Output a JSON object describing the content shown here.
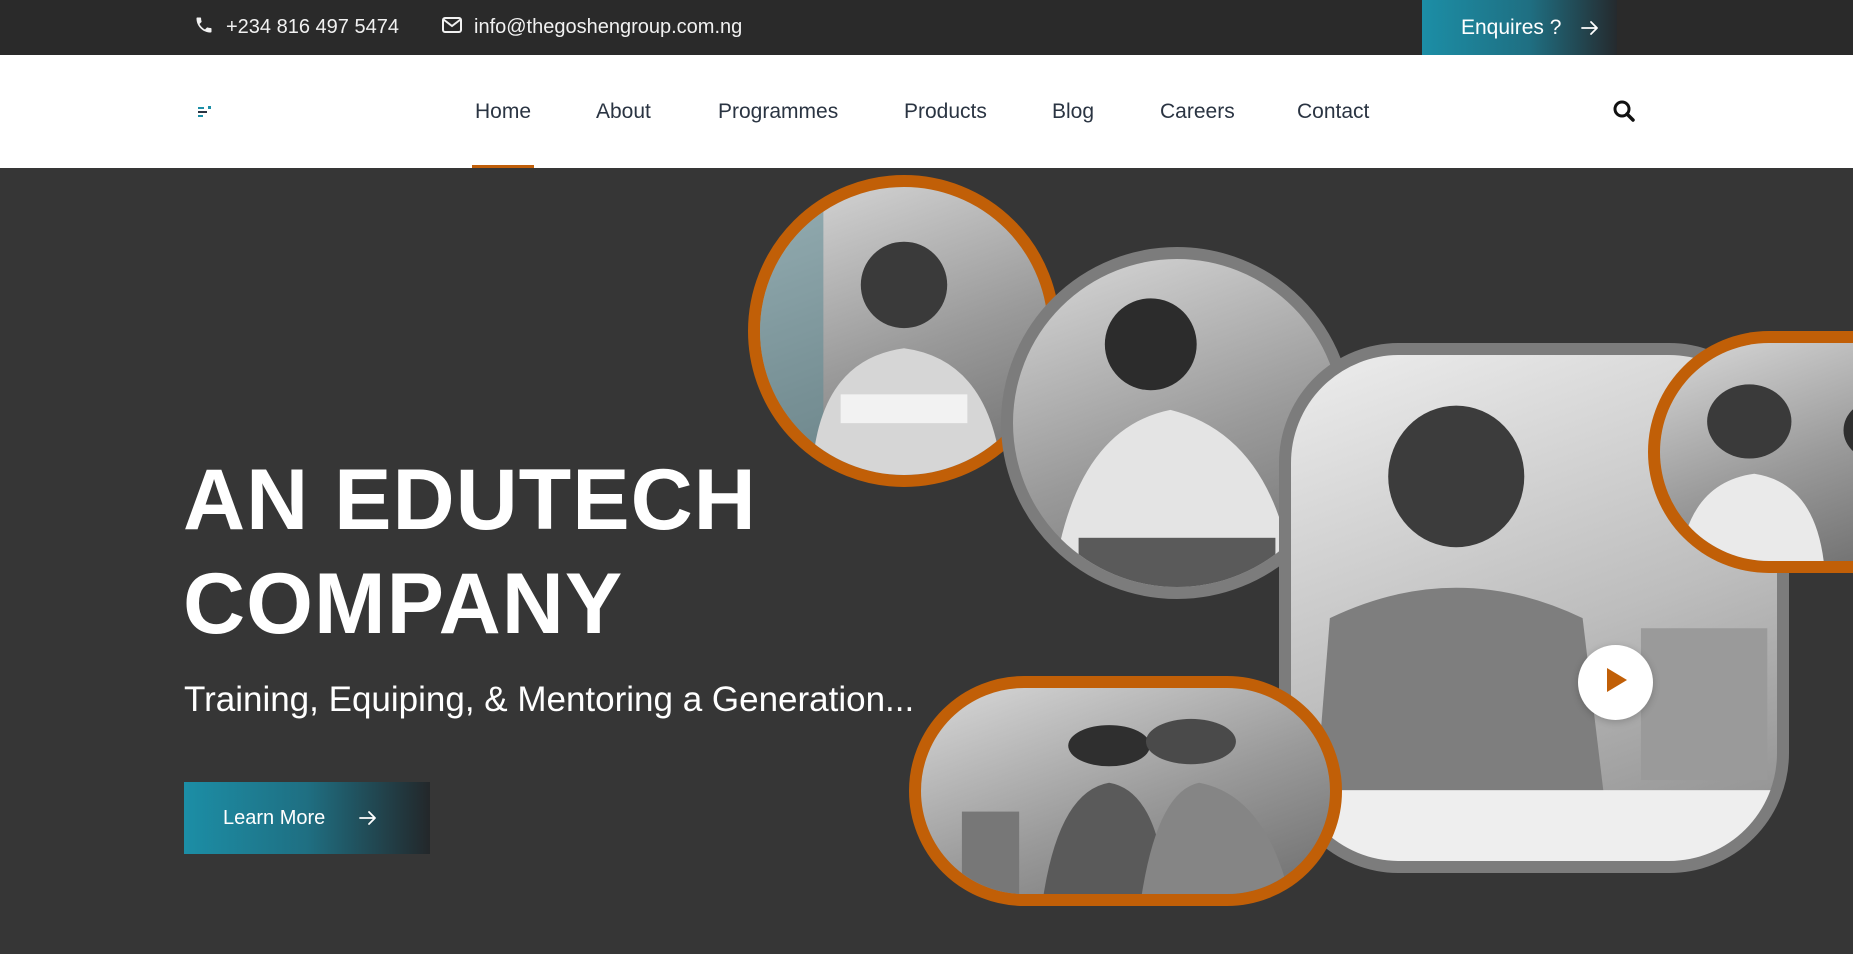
{
  "topbar": {
    "phone": "+234 816 497 5474",
    "email": "info@thegoshengroup.com.ng",
    "enquire_label": "Enquires ?"
  },
  "nav": {
    "items": [
      {
        "label": "Home",
        "active": true
      },
      {
        "label": "About"
      },
      {
        "label": "Programmes"
      },
      {
        "label": "Products"
      },
      {
        "label": "Blog"
      },
      {
        "label": "Careers"
      },
      {
        "label": "Contact"
      }
    ]
  },
  "hero": {
    "title_line1": "AN EDUTECH",
    "title_line2": "COMPANY",
    "subtitle": "Training, Equiping, & Mentoring a Generation...",
    "cta_label": "Learn More"
  },
  "colors": {
    "accent_orange": "#c15f07",
    "accent_teal": "#1c8ea6",
    "hero_bg": "#363636",
    "topbar_bg": "#2a2a2a"
  },
  "icons": [
    "phone-icon",
    "envelope-icon",
    "arrow-right-icon",
    "search-icon",
    "play-icon"
  ]
}
